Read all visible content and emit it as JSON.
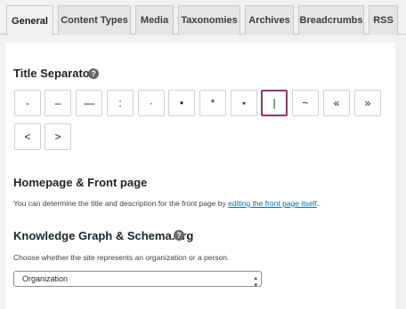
{
  "tabs": [
    {
      "label": "General",
      "active": true
    },
    {
      "label": "Content Types"
    },
    {
      "label": "Media"
    },
    {
      "label": "Taxonomies"
    },
    {
      "label": "Archives"
    },
    {
      "label": "Breadcrumbs"
    },
    {
      "label": "RSS"
    }
  ],
  "title_separator": {
    "heading": "Title Separator",
    "help_glyph": "?",
    "options": [
      "-",
      "–",
      "—",
      ":",
      "·",
      "•",
      "*",
      "⋆",
      "|",
      "~",
      "«",
      "»",
      "<",
      ">"
    ],
    "selected": "|"
  },
  "homepage": {
    "heading": "Homepage & Front page",
    "description_prefix": "You can determine the title and description for the front page by ",
    "link_text": "editing the front page itself",
    "description_suffix": "."
  },
  "knowledge_graph": {
    "heading": "Knowledge Graph & Schema.org",
    "help_glyph": "?",
    "description": "Choose whether the site represents an organization or a person.",
    "select_value": "Organization"
  },
  "colors": {
    "selected_border": "#8c3a66",
    "link": "#0a6da8"
  }
}
